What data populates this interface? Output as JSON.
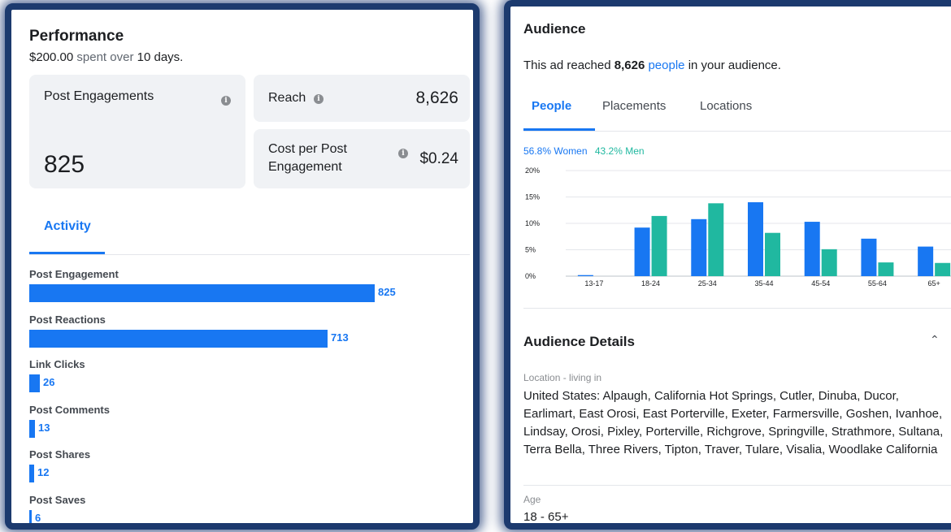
{
  "performance": {
    "title": "Performance",
    "spent_amount": "$200.00",
    "spent_mid": "spent over",
    "days": "10 days.",
    "post_engagements": {
      "label": "Post Engagements",
      "value": "825"
    },
    "reach": {
      "label": "Reach",
      "value": "8,626"
    },
    "cost_per_engagement": {
      "label_line1": "Cost per Post",
      "label_line2": "Engagement",
      "value": "$0.24"
    },
    "info_icon": "info-icon"
  },
  "activity": {
    "tab_label": "Activity",
    "items": [
      {
        "label": "Post Engagement",
        "value": "825",
        "count": 825
      },
      {
        "label": "Post Reactions",
        "value": "713",
        "count": 713
      },
      {
        "label": "Link Clicks",
        "value": "26",
        "count": 26
      },
      {
        "label": "Post Comments",
        "value": "13",
        "count": 13
      },
      {
        "label": "Post Shares",
        "value": "12",
        "count": 12
      },
      {
        "label": "Post Saves",
        "value": "6",
        "count": 6
      }
    ]
  },
  "audience": {
    "title": "Audience",
    "reach_prefix": "This ad reached",
    "reach_count": "8,626",
    "reach_link": "people",
    "reach_suffix": "in your audience.",
    "tabs": [
      "People",
      "Placements",
      "Locations"
    ],
    "legend_women": "56.8% Women",
    "legend_men": "43.2% Men"
  },
  "chart_data": {
    "type": "bar",
    "categories": [
      "13-17",
      "18-24",
      "25-34",
      "35-44",
      "45-54",
      "55-64",
      "65+"
    ],
    "series": [
      {
        "name": "Women",
        "color": "#1877f2",
        "values": [
          0.2,
          9.2,
          10.8,
          14.0,
          10.3,
          7.1,
          5.6
        ]
      },
      {
        "name": "Men",
        "color": "#20b8a0",
        "values": [
          0,
          11.4,
          13.8,
          8.2,
          5.1,
          2.6,
          2.5
        ]
      }
    ],
    "yticks": [
      "0%",
      "5%",
      "10%",
      "15%",
      "20%"
    ],
    "ylim": [
      0,
      20
    ]
  },
  "audience_details": {
    "title": "Audience Details",
    "location_label": "Location - living in",
    "location_text": "United States: Alpaugh, California Hot Springs, Cutler, Dinuba, Ducor, Earlimart, East Orosi, East Porterville, Exeter, Farmersville, Goshen, Ivanhoe, Lindsay, Orosi, Pixley, Porterville, Richgrove, Springville, Strathmore, Sultana, Terra Bella, Three Rivers, Tipton, Traver, Tulare, Visalia, Woodlake California",
    "age_label": "Age",
    "age_value": "18 - 65+",
    "collapse_icon": "chevron-up-icon"
  }
}
